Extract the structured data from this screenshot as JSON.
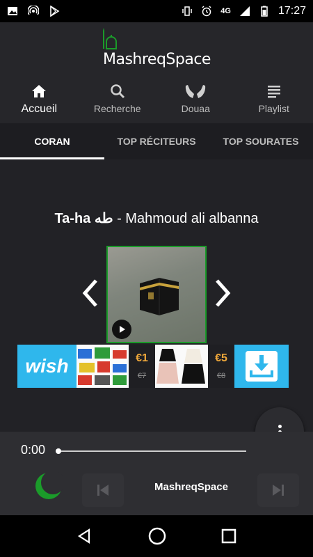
{
  "status_bar": {
    "time": "17:27",
    "network": "4G"
  },
  "app": {
    "logo_text": "MashreqSpace"
  },
  "nav": {
    "items": [
      {
        "label": "Accueil",
        "icon": "home-icon",
        "active": true
      },
      {
        "label": "Recherche",
        "icon": "search-icon",
        "active": false
      },
      {
        "label": "Douaa",
        "icon": "praying-hands-icon",
        "active": false
      },
      {
        "label": "Playlist",
        "icon": "playlist-icon",
        "active": false
      }
    ]
  },
  "tabs": [
    {
      "label": "CORAN",
      "active": true
    },
    {
      "label": "TOP RÉCITEURS",
      "active": false
    },
    {
      "label": "TOP SOURATES",
      "active": false
    }
  ],
  "track": {
    "surah": "Ta-ha",
    "surah_arabic": "طه",
    "separator": " - ",
    "reciter": "Mahmoud ali albanna"
  },
  "ad": {
    "brand": "wish",
    "offers": [
      {
        "price": "€1",
        "old_price": "€7"
      },
      {
        "price": "€5",
        "old_price": "€8"
      }
    ]
  },
  "player": {
    "elapsed": "0:00",
    "progress": 0.0,
    "title": "MashreqSpace"
  },
  "colors": {
    "accent_green": "#1b9b2a",
    "wish_blue": "#2fb7ec",
    "price_orange": "#f0a83a"
  }
}
